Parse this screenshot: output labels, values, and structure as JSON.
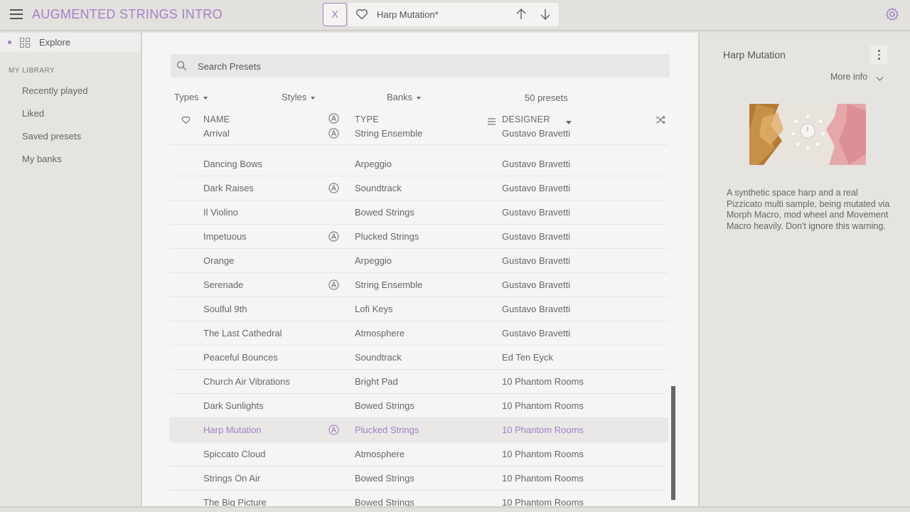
{
  "header": {
    "app_title": "AUGMENTED STRINGS INTRO",
    "close_label": "X",
    "current_preset": "Harp Mutation*"
  },
  "sidebar": {
    "explore_label": "Explore",
    "library_heading": "MY LIBRARY",
    "items": [
      {
        "label": "Recently played"
      },
      {
        "label": "Liked"
      },
      {
        "label": "Saved presets"
      },
      {
        "label": "My banks"
      }
    ]
  },
  "main": {
    "search_placeholder": "Search Presets",
    "filters": {
      "types": "Types",
      "styles": "Styles",
      "banks": "Banks"
    },
    "preset_count": "50 presets",
    "columns": {
      "name": "NAME",
      "type": "TYPE",
      "designer": "DESIGNER"
    },
    "rows": [
      {
        "name": "Arrival",
        "type": "String Ensemble",
        "designer": "Gustavo Bravetti",
        "arturia": true
      },
      {
        "name": "Dancing Bows",
        "type": "Arpeggio",
        "designer": "Gustavo Bravetti",
        "arturia": false
      },
      {
        "name": "Dark Raises",
        "type": "Soundtrack",
        "designer": "Gustavo Bravetti",
        "arturia": true
      },
      {
        "name": "Il Violino",
        "type": "Bowed Strings",
        "designer": "Gustavo Bravetti",
        "arturia": false
      },
      {
        "name": "Impetuous",
        "type": "Plucked Strings",
        "designer": "Gustavo Bravetti",
        "arturia": true
      },
      {
        "name": "Orange",
        "type": "Arpeggio",
        "designer": "Gustavo Bravetti",
        "arturia": false
      },
      {
        "name": "Serenade",
        "type": "String Ensemble",
        "designer": "Gustavo Bravetti",
        "arturia": true
      },
      {
        "name": "Soulful 9th",
        "type": "Lofi Keys",
        "designer": "Gustavo Bravetti",
        "arturia": false
      },
      {
        "name": "The Last Cathedral",
        "type": "Atmosphere",
        "designer": "Gustavo Bravetti",
        "arturia": false
      },
      {
        "name": "Peaceful Bounces",
        "type": "Soundtrack",
        "designer": "Ed Ten Eyck",
        "arturia": false
      },
      {
        "name": "Church Air Vibrations",
        "type": "Bright Pad",
        "designer": "10 Phantom Rooms",
        "arturia": false
      },
      {
        "name": "Dark Sunlights",
        "type": "Bowed Strings",
        "designer": "10 Phantom Rooms",
        "arturia": false
      },
      {
        "name": "Harp Mutation",
        "type": "Plucked Strings",
        "designer": "10 Phantom Rooms",
        "arturia": true,
        "selected": true
      },
      {
        "name": "Spiccato Cloud",
        "type": "Atmosphere",
        "designer": "10 Phantom Rooms",
        "arturia": false
      },
      {
        "name": "Strings On Air",
        "type": "Bowed Strings",
        "designer": "10 Phantom Rooms",
        "arturia": false
      },
      {
        "name": "The Big Picture",
        "type": "Bowed Strings",
        "designer": "10 Phantom Rooms",
        "arturia": false
      }
    ]
  },
  "details": {
    "title": "Harp Mutation",
    "more_info": "More info",
    "description": "A synthetic space harp and a real Pizzicato multi sample, being mutated via Morph Macro, mod wheel and Movement Macro heavily. Don't ignore this warning."
  },
  "colors": {
    "accent": "#a27fc6",
    "background": "#e3e1de",
    "list_bg": "#f6f5f4"
  },
  "icons": [
    "hamburger-icon",
    "heart-icon",
    "arrow-up-icon",
    "arrow-down-icon",
    "gear-icon",
    "grid-icon",
    "search-icon",
    "arturia-icon",
    "sort-icon",
    "shuffle-icon",
    "kebab-icon",
    "chevron-down-icon"
  ]
}
